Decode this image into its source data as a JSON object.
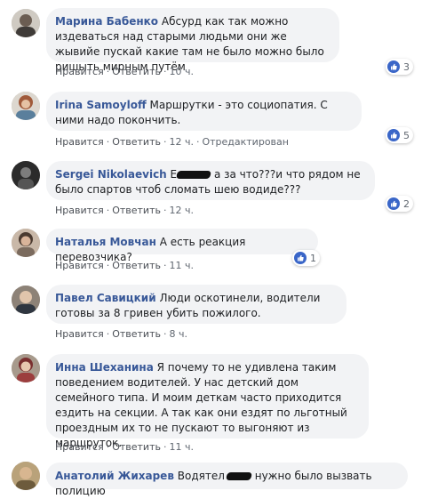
{
  "actions": {
    "like": "Нравится",
    "reply": "Ответить",
    "edited": "Отредактирован"
  },
  "comments": [
    {
      "author": "Марина Бабенко",
      "text": "Абсурд как так можно издеваться над старыми людьми они же жывийе пускай какие там не было можно было ришыть мирным путём",
      "time": "10 ч.",
      "likes": "3"
    },
    {
      "author": "Irina Samoyloff",
      "text": "Маршрутки - это социопатия. С ними надо покончить.",
      "time": "12 ч.",
      "likes": "5"
    },
    {
      "author": "Sergei Nikolaevich",
      "text_pre": "Е",
      "text": "а за что???и что рядом не было спартов чтоб сломать шею водиде???",
      "time": "12 ч.",
      "likes": "2"
    },
    {
      "author": "Наталья Мовчан",
      "text": "А есть реакция перевозчика?",
      "time": "11 ч.",
      "likes": "1"
    },
    {
      "author": "Павел Савицкий",
      "text": "Люди оскотинели, водители готовы за 8 гривен убить пожилого.",
      "time": "8 ч."
    },
    {
      "author": "Инна Шеханина",
      "text": "Я почему то не удивлена таким поведением водителей. У нас детский дом семейного типа. И моим деткам часто приходится ездить на секции. А так как они ездят по льготный проездным их то не пускают то выгоняют из маршруток.",
      "time": "11 ч."
    },
    {
      "author": "Анатолий Жихарев",
      "text_pre": "Водятел",
      "text": "нужно было вызвать полицию"
    }
  ]
}
